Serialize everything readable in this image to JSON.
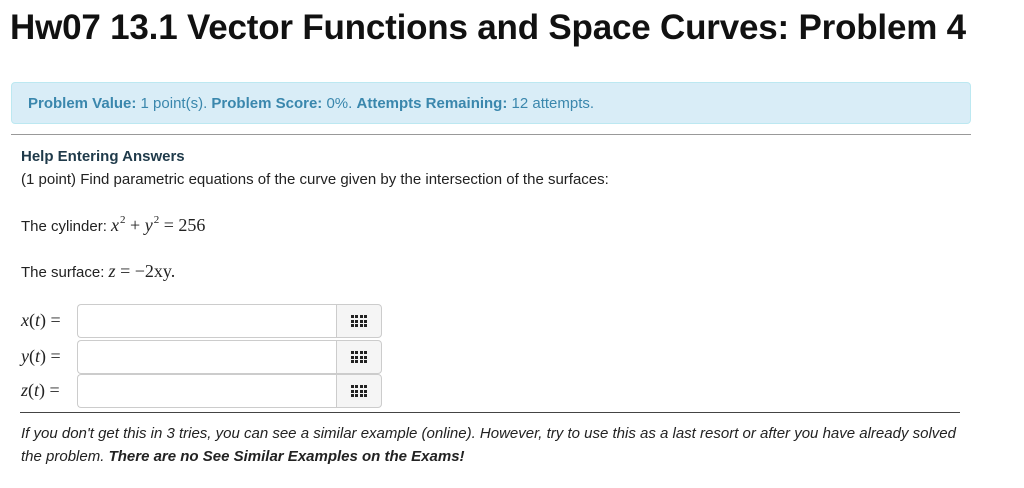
{
  "header": {
    "title": "Hw07 13.1 Vector Functions and Space Curves: Problem 4"
  },
  "info": {
    "value_label": "Problem Value:",
    "value_text": "1 point(s).",
    "score_label": "Problem Score:",
    "score_text": "0%.",
    "attempts_label": "Attempts Remaining:",
    "attempts_text": "12 attempts."
  },
  "problem": {
    "help_link": "Help Entering Answers",
    "prompt": "(1 point) Find parametric equations of the curve given by the intersection of the surfaces:",
    "cylinder_label": "The cylinder:",
    "cylinder_constant": "256",
    "surface_label": "The surface:",
    "surface_rhs": "−2xy."
  },
  "answers": [
    {
      "var": "x",
      "value": "",
      "placeholder": ""
    },
    {
      "var": "y",
      "value": "",
      "placeholder": ""
    },
    {
      "var": "z",
      "value": "",
      "placeholder": ""
    }
  ],
  "footer": {
    "note": "If you don't get this in 3 tries, you can see a similar example (online). However, try to use this as a last resort or after you have already solved the problem.",
    "note_bold": "There are no See Similar Examples on the Exams!"
  },
  "icons": {
    "equation_editor": "grid-icon"
  },
  "colors": {
    "info_bg": "#d9edf7",
    "info_text": "#3a87ad"
  }
}
